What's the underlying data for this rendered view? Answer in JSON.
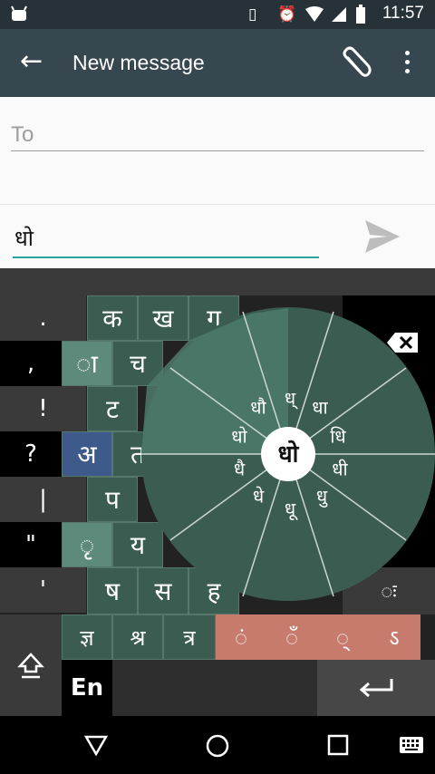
{
  "status_bar": {
    "time": "11:57"
  },
  "toolbar": {
    "title": "New message"
  },
  "compose": {
    "to_placeholder": "To",
    "message_text": "धो"
  },
  "keyboard": {
    "side_keys": [
      ".",
      ",",
      "!",
      "?",
      "|",
      "\"",
      "'"
    ],
    "rows": {
      "r1": [
        "क",
        "ख",
        "ग"
      ],
      "r2": [
        "ा",
        "च"
      ],
      "r3": [
        "ट"
      ],
      "r4": [
        "अ",
        "त"
      ],
      "r5": [
        "प"
      ],
      "r6": [
        "ृ",
        "य"
      ],
      "r7": [
        "ष",
        "स",
        "ह"
      ]
    },
    "conjuncts": [
      "ज्ञ",
      "श्र",
      "त्र"
    ],
    "diacritics": [
      "ं",
      "ँ",
      "्",
      "ऽ"
    ],
    "language_key": "En",
    "wheel": {
      "center": "धो",
      "options": [
        "धौ",
        "ध्",
        "धा",
        "धि",
        "धी",
        "धु",
        "धू",
        "धे",
        "धै",
        "धो"
      ]
    }
  }
}
